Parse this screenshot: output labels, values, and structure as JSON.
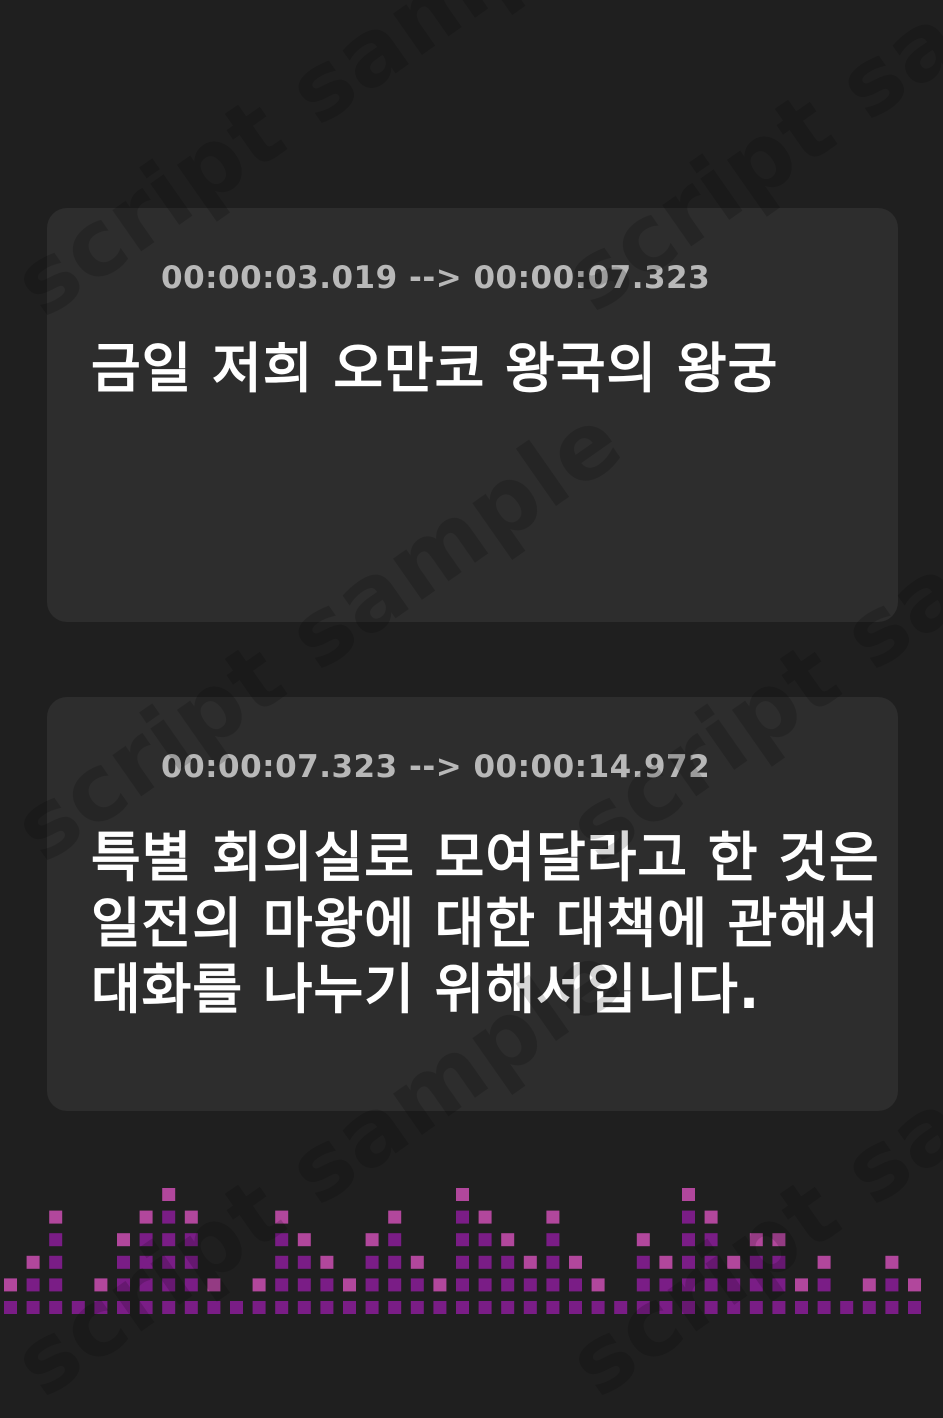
{
  "watermark": {
    "text": "script sample"
  },
  "subtitles": [
    {
      "timestamp": "00:00:03.019 --> 00:00:07.323",
      "text": "금일 저희 오만코 왕국의 왕궁",
      "icon": "audio-wave-icon"
    },
    {
      "timestamp": "00:00:07.323 --> 00:00:14.972",
      "text": "특별 회의실로 모여달라고 한 것은\n일전의 마왕에 대한 대책에 관해서\n대화를 나누기 위해서입니다.",
      "icon": "audio-wave-icon"
    }
  ],
  "colors": {
    "background": "#1f1f1f",
    "card": "#2d2d2d",
    "timestamp": "#b8b8b8",
    "caption": "#ffffff",
    "accent_light": "#e070f0",
    "accent_dark": "#9a2fb0",
    "equalizer_low": "#7a1d86",
    "equalizer_high": "#b1479c"
  },
  "equalizer_levels": [
    2,
    3,
    5,
    1,
    2,
    4,
    5,
    6,
    5,
    2,
    1,
    2,
    5,
    4,
    3,
    2,
    4,
    5,
    3,
    2,
    6,
    5,
    4,
    3,
    5,
    3,
    2,
    1,
    4,
    3,
    6,
    5,
    3,
    4,
    4,
    2,
    3,
    1,
    2,
    3,
    2
  ]
}
